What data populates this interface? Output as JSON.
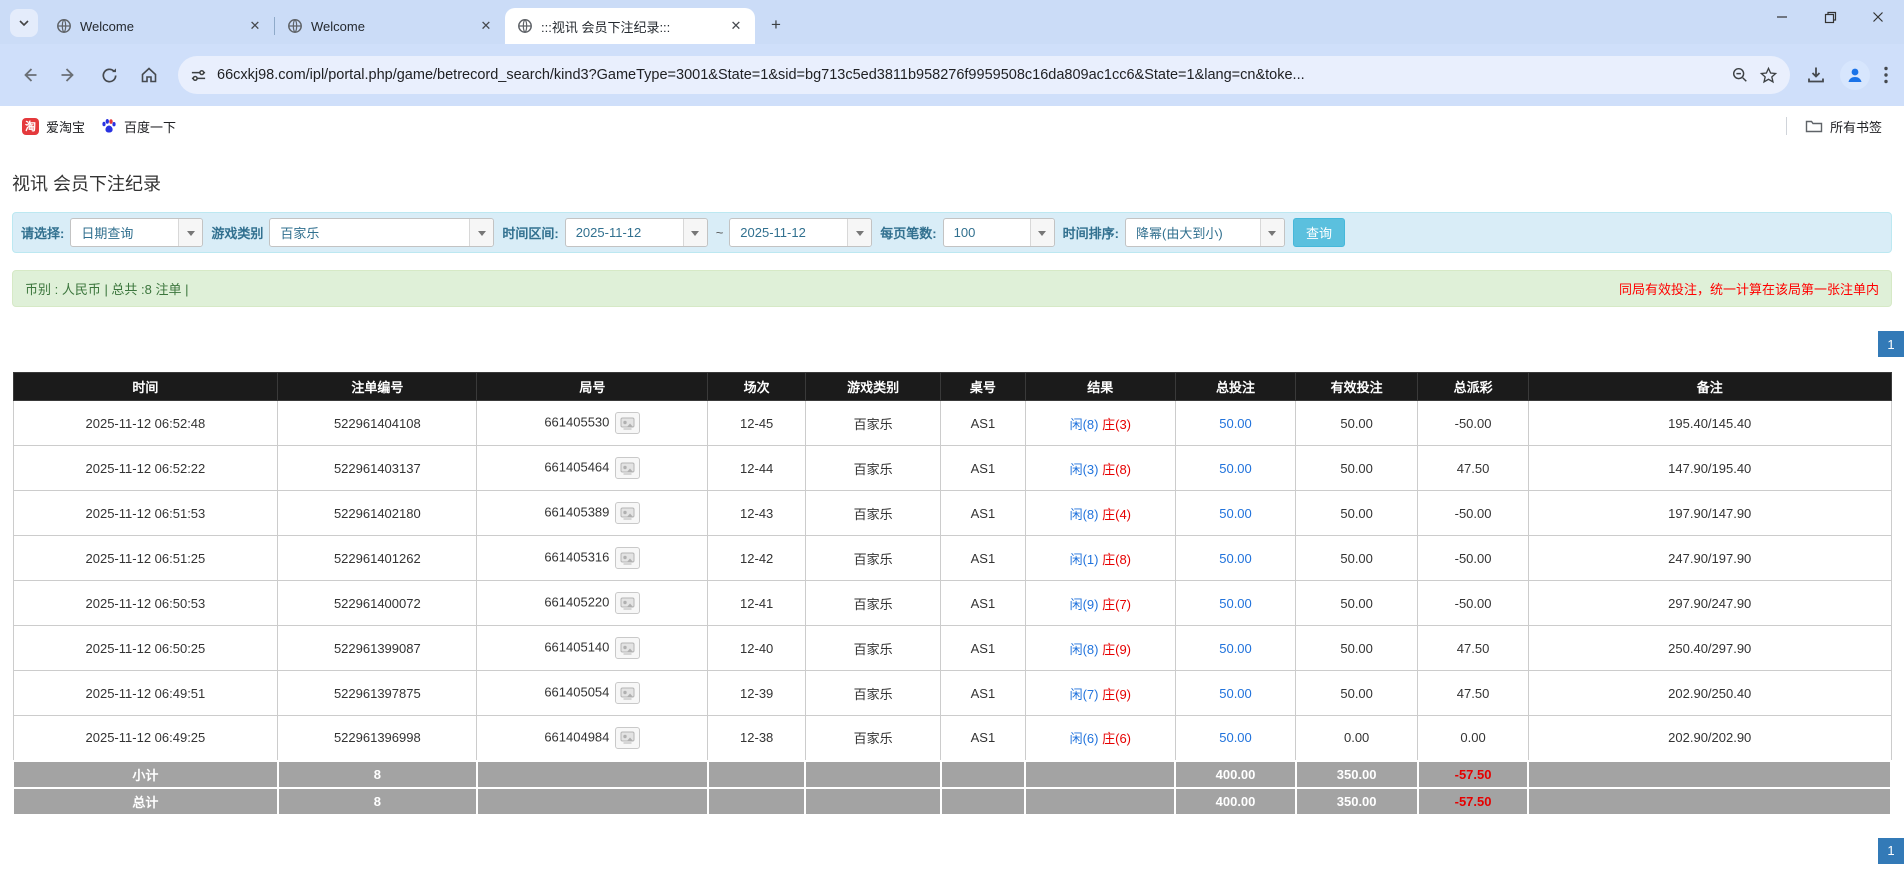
{
  "browser": {
    "tabs": [
      {
        "title": "Welcome",
        "active": false
      },
      {
        "title": "Welcome",
        "active": false
      },
      {
        "title": ":::视讯 会员下注纪录:::",
        "active": true
      }
    ],
    "url": "66cxkj98.com/ipl/portal.php/game/betrecord_search/kind3?GameType=3001&State=1&sid=bg713c5ed3811b958276f9959508c16da809ac1cc6&State=1&lang=cn&toke...",
    "bookmarks": [
      {
        "label": "爱淘宝",
        "icon": "taobao-icon"
      },
      {
        "label": "百度一下",
        "icon": "baidu-icon"
      }
    ],
    "all_bookmarks_label": "所有书签"
  },
  "page": {
    "title": "视讯 会员下注纪录",
    "filters": {
      "items": [
        {
          "label": "请选择:",
          "value": "日期查询"
        },
        {
          "label": "游戏类别",
          "value": "百家乐"
        },
        {
          "label": "时间区间:",
          "value": "2025-11-12"
        },
        {
          "label": "~",
          "value": "2025-11-12"
        },
        {
          "label": "每页笔数:",
          "value": "100"
        },
        {
          "label": "时间排序:",
          "value": "降幂(由大到小)"
        }
      ],
      "search_label": "查询"
    },
    "summary": {
      "left": "币别 : 人民币 | 总共 :8 注单 |",
      "right": "同局有效投注，统一计算在该局第一张注单内"
    },
    "pagination": {
      "current": "1"
    },
    "table": {
      "headers": [
        "时间",
        "注单编号",
        "局号",
        "场次",
        "游戏类别",
        "桌号",
        "结果",
        "总投注",
        "有效投注",
        "总派彩",
        "备注"
      ],
      "rows": [
        {
          "time": "2025-11-12 06:52:48",
          "bet_id": "522961404108",
          "round_id": "661405530",
          "session": "12-45",
          "game": "百家乐",
          "table": "AS1",
          "result_player": "闲(8)",
          "result_banker": "庄(3)",
          "total_bet": "50.00",
          "valid_bet": "50.00",
          "payout": "-50.00",
          "note": "195.40/145.40"
        },
        {
          "time": "2025-11-12 06:52:22",
          "bet_id": "522961403137",
          "round_id": "661405464",
          "session": "12-44",
          "game": "百家乐",
          "table": "AS1",
          "result_player": "闲(3)",
          "result_banker": "庄(8)",
          "total_bet": "50.00",
          "valid_bet": "50.00",
          "payout": "47.50",
          "note": "147.90/195.40"
        },
        {
          "time": "2025-11-12 06:51:53",
          "bet_id": "522961402180",
          "round_id": "661405389",
          "session": "12-43",
          "game": "百家乐",
          "table": "AS1",
          "result_player": "闲(8)",
          "result_banker": "庄(4)",
          "total_bet": "50.00",
          "valid_bet": "50.00",
          "payout": "-50.00",
          "note": "197.90/147.90"
        },
        {
          "time": "2025-11-12 06:51:25",
          "bet_id": "522961401262",
          "round_id": "661405316",
          "session": "12-42",
          "game": "百家乐",
          "table": "AS1",
          "result_player": "闲(1)",
          "result_banker": "庄(8)",
          "total_bet": "50.00",
          "valid_bet": "50.00",
          "payout": "-50.00",
          "note": "247.90/197.90"
        },
        {
          "time": "2025-11-12 06:50:53",
          "bet_id": "522961400072",
          "round_id": "661405220",
          "session": "12-41",
          "game": "百家乐",
          "table": "AS1",
          "result_player": "闲(9)",
          "result_banker": "庄(7)",
          "total_bet": "50.00",
          "valid_bet": "50.00",
          "payout": "-50.00",
          "note": "297.90/247.90"
        },
        {
          "time": "2025-11-12 06:50:25",
          "bet_id": "522961399087",
          "round_id": "661405140",
          "session": "12-40",
          "game": "百家乐",
          "table": "AS1",
          "result_player": "闲(8)",
          "result_banker": "庄(9)",
          "total_bet": "50.00",
          "valid_bet": "50.00",
          "payout": "47.50",
          "note": "250.40/297.90"
        },
        {
          "time": "2025-11-12 06:49:51",
          "bet_id": "522961397875",
          "round_id": "661405054",
          "session": "12-39",
          "game": "百家乐",
          "table": "AS1",
          "result_player": "闲(7)",
          "result_banker": "庄(9)",
          "total_bet": "50.00",
          "valid_bet": "50.00",
          "payout": "47.50",
          "note": "202.90/250.40"
        },
        {
          "time": "2025-11-12 06:49:25",
          "bet_id": "522961396998",
          "round_id": "661404984",
          "session": "12-38",
          "game": "百家乐",
          "table": "AS1",
          "result_player": "闲(6)",
          "result_banker": "庄(6)",
          "total_bet": "50.00",
          "valid_bet": "0.00",
          "payout": "0.00",
          "note": "202.90/202.90"
        }
      ],
      "subtotal": {
        "label": "小计",
        "count": "8",
        "total_bet": "400.00",
        "valid_bet": "350.00",
        "payout": "-57.50"
      },
      "total": {
        "label": "总计",
        "count": "8",
        "total_bet": "400.00",
        "valid_bet": "350.00",
        "payout": "-57.50"
      }
    }
  },
  "colors": {
    "accent_blue": "#337ab7",
    "link_blue": "#2173dc",
    "result_red": "#e60000",
    "filter_bg": "#d9edf7",
    "summary_bg": "#dff0d8",
    "header_bg": "#1b1b1b",
    "footer_row_bg": "#a3a3a3",
    "search_button": "#5bc0de"
  }
}
